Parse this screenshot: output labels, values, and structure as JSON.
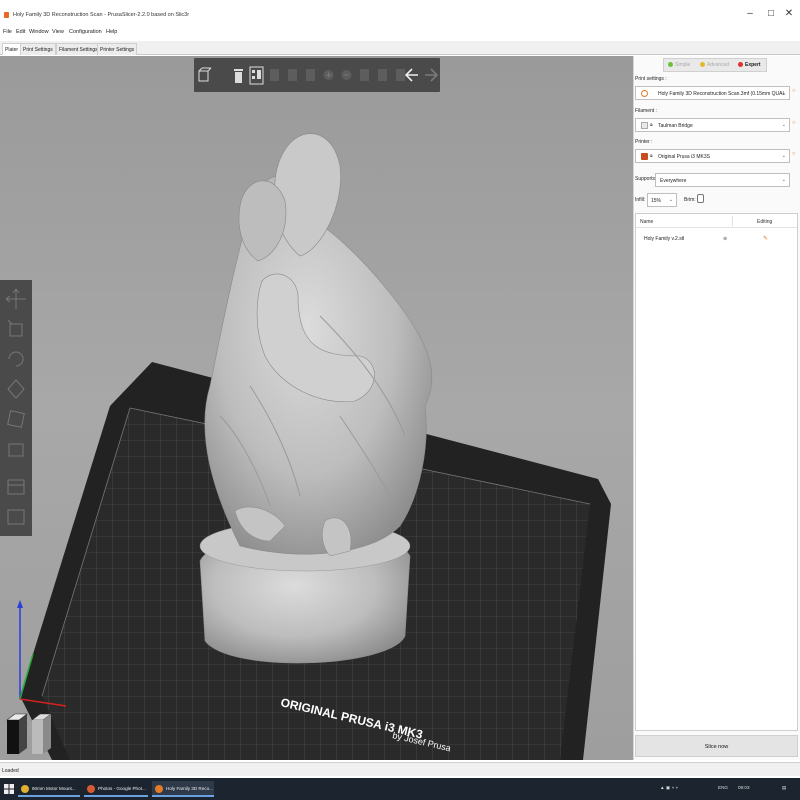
{
  "window": {
    "title": "Holy Family 3D Reconstruction Scan - PrusaSlicer-2.2.0 based on Slic3r",
    "controls": {
      "minimize": "–",
      "maximize": "□",
      "close": "✕"
    }
  },
  "menu": [
    "File",
    "Edit",
    "Window",
    "View",
    "Configuration",
    "Help"
  ],
  "tabs": [
    "Plater",
    "Print Settings",
    "Filament Settings",
    "Printer Settings"
  ],
  "modes": [
    "Simple",
    "Advanced",
    "Expert"
  ],
  "sidebar": {
    "print_settings_label": "Print settings :",
    "print_settings_value": "Holy Family 3D Reconstruction Scan.3mf (0.15mm QUAL",
    "filament_label": "Filament :",
    "filament_value": "Taulman Bridge",
    "printer_label": "Printer :",
    "printer_value": "Original Prusa i3 MK3S",
    "supports_label": "Supports:",
    "supports_value": "Everywhere",
    "infill_label": "Infill:",
    "infill_value": "15%",
    "brim_label": "Brim:"
  },
  "object_list": {
    "col_name": "Name",
    "col_editing": "Editing",
    "rows": [
      {
        "name": "Holy Family v.2.stl"
      }
    ]
  },
  "slice_button": "Slice now",
  "status": "Loaded",
  "bed_label_line1": "ORIGINAL PRUSA i3 MK3",
  "bed_label_line2": "by Josef Prusa",
  "taskbar": {
    "items": [
      "60mm Motor Mount...",
      "Photos - Google Phot...",
      "Holy Family 3D Reco..."
    ],
    "tray_lang": "ENG",
    "tray_time": "09:03"
  },
  "colors": {
    "accent": "#e57a28",
    "expert": "#e0302a",
    "advanced": "#e6b82a",
    "simple": "#6cbf3a",
    "toolbar": "#4a4a4a",
    "taskbar": "#1c2430"
  }
}
